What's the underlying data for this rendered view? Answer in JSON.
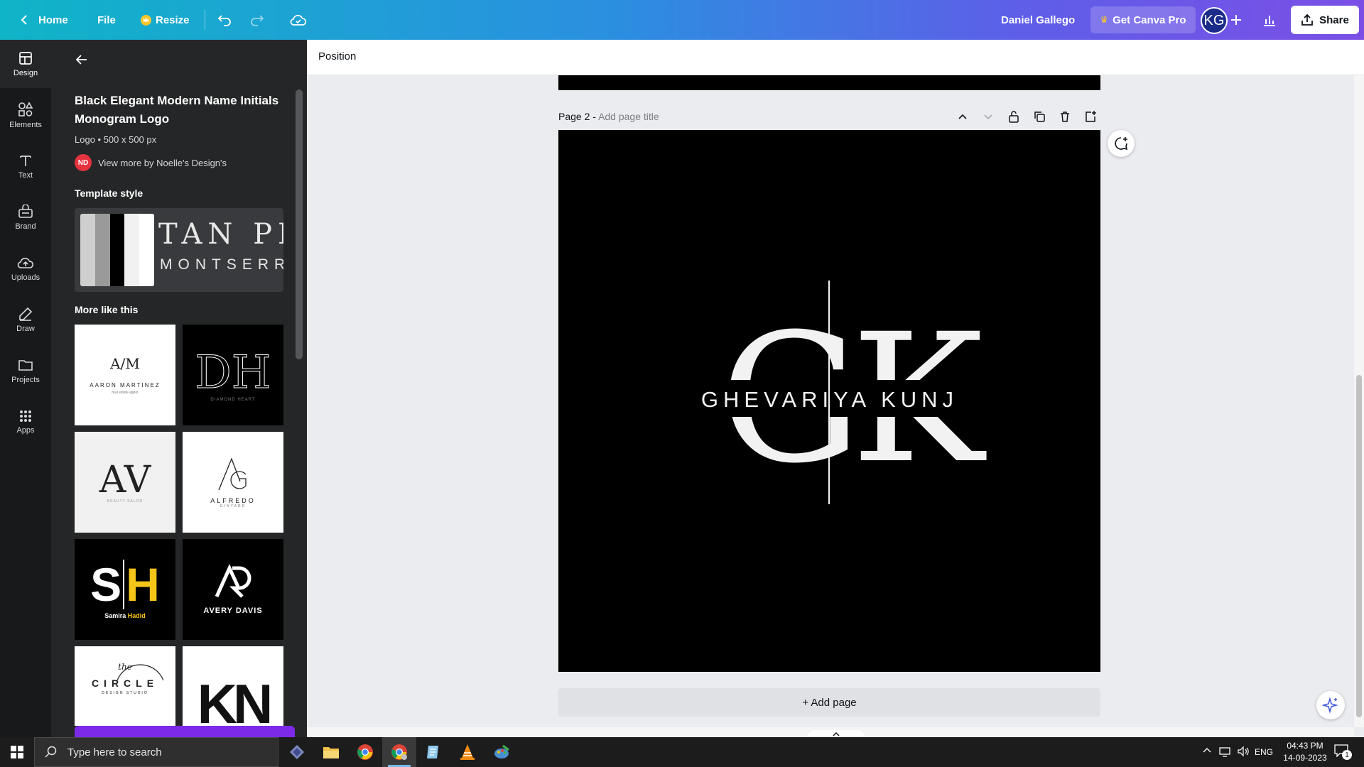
{
  "topbar": {
    "home_label": "Home",
    "file_label": "File",
    "resize_label": "Resize",
    "user_name": "Daniel Gallego",
    "pro_label": "Get Canva Pro",
    "avatar_initials": "KG",
    "share_label": "Share"
  },
  "rail": {
    "items": [
      {
        "label": "Design",
        "icon": "design-icon"
      },
      {
        "label": "Elements",
        "icon": "elements-icon"
      },
      {
        "label": "Text",
        "icon": "text-icon"
      },
      {
        "label": "Brand",
        "icon": "brand-icon"
      },
      {
        "label": "Uploads",
        "icon": "uploads-icon"
      },
      {
        "label": "Draw",
        "icon": "draw-icon"
      },
      {
        "label": "Projects",
        "icon": "projects-icon"
      },
      {
        "label": "Apps",
        "icon": "apps-icon"
      }
    ]
  },
  "panel": {
    "title": "Black Elegant Modern Name Initials Monogram Logo",
    "meta": "Logo • 500 x 500 px",
    "author_initials": "ND",
    "author_link": "View more by Noelle's Design's",
    "template_style_heading": "Template style",
    "style_font_1": "TAN PE",
    "style_font_2": "MONTSERR",
    "more_heading": "More like this",
    "thumbs": {
      "t1_mono": "A/M",
      "t1_name": "AARON MARTINEZ",
      "t1_tag": "real estate agent",
      "t2_mono": "DH",
      "t2_name": "DIAMOND HEART",
      "t3_mono": "AV",
      "t3_sub": "BEAUTY SALON",
      "t4_name": "ALFREDO",
      "t4_sub": "GINYARD",
      "t5_first": "Samira",
      "t5_last": "Hadid",
      "t6_name": "AVERY DAVIS",
      "t7_word": "CIRCLE",
      "t7_the": "the",
      "t7_sub": "DESIGN STUDIO",
      "t8_mono": "KN"
    }
  },
  "canvas": {
    "context_label": "Position",
    "page_label": "Page 2 -",
    "page_title_placeholder": "Add page title",
    "logo_letter_1": "G",
    "logo_letter_2": "K",
    "logo_name": "GHEVARIYA KUNJ",
    "add_page_label": "+ Add page"
  },
  "taskbar": {
    "search_placeholder": "Type here to search",
    "lang": "ENG",
    "time": "04:43 PM",
    "date": "14-09-2023",
    "notif_count": "1"
  },
  "colors": {
    "gradient_start": "#10b4c8",
    "gradient_end": "#7b4fe6",
    "panel_bg": "#252627",
    "rail_bg": "#18191b",
    "canva_purple": "#7d2ae8"
  }
}
